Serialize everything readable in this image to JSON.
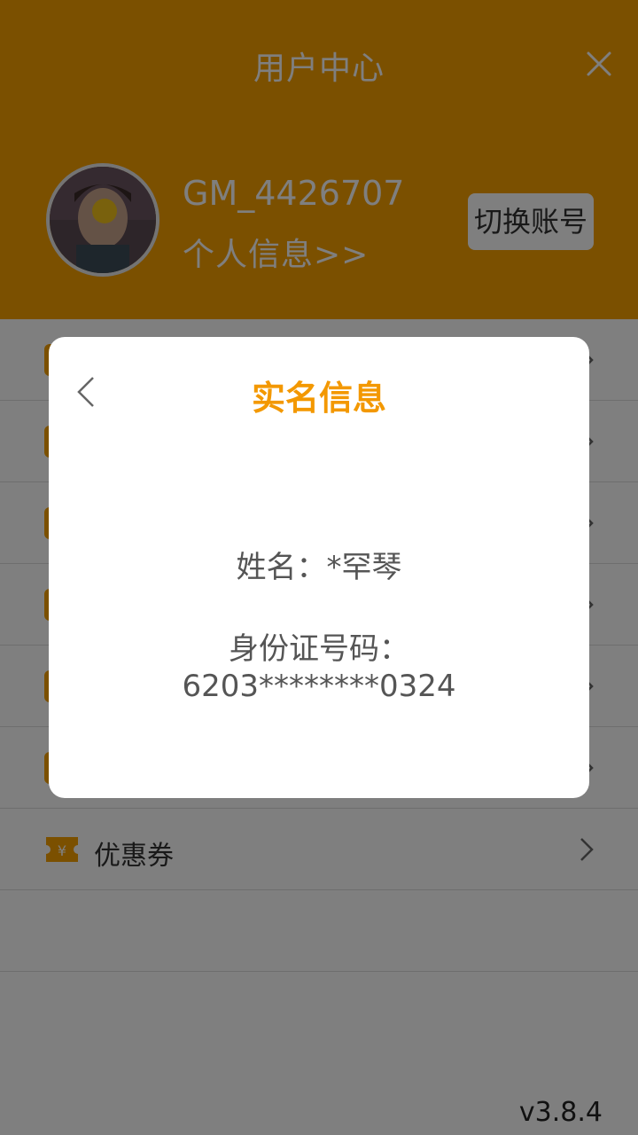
{
  "header": {
    "title": "用户中心",
    "close_icon": "close-icon",
    "username": "GM_4426707",
    "profile_link": "个人信息>>",
    "switch_account": "切换账号"
  },
  "menu": {
    "items": [
      {
        "label": "",
        "icon": "menu-icon"
      },
      {
        "label": "",
        "icon": "menu-icon"
      },
      {
        "label": "",
        "icon": "menu-icon"
      },
      {
        "label": "",
        "icon": "menu-icon"
      },
      {
        "label": "",
        "icon": "menu-icon"
      },
      {
        "label": "",
        "icon": "menu-icon"
      },
      {
        "label": "优惠券",
        "icon": "coupon-icon"
      },
      {
        "label": "",
        "icon": ""
      }
    ]
  },
  "version": "v3.8.4",
  "dialog": {
    "title": "实名信息",
    "name_line": "姓名：*罕琴",
    "id_label": "身份证号码：",
    "id_value": "6203********0324"
  },
  "colors": {
    "accent": "#f7a000",
    "dialog_title": "#f39800"
  }
}
